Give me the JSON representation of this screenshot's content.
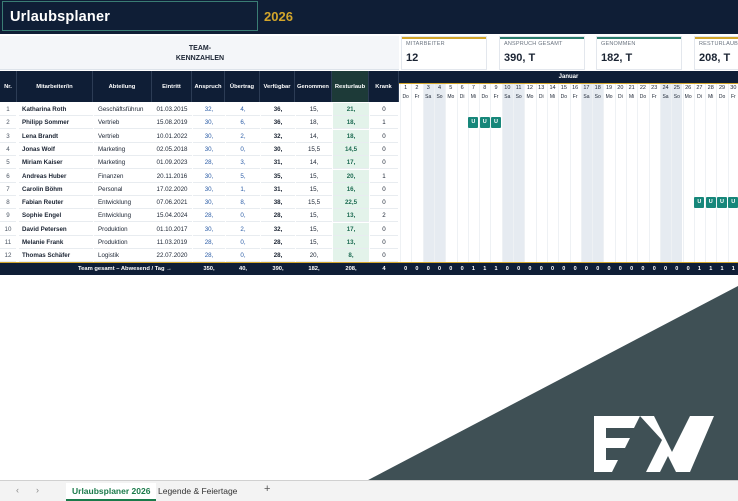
{
  "header": {
    "title": "Urlaubsplaner",
    "year": "2026"
  },
  "kpi": {
    "team_label_1": "TEAM-",
    "team_label_2": "KENNZAHLEN",
    "cards": [
      {
        "label": "MITARBEITER",
        "value": "12",
        "color": "#d2a52b"
      },
      {
        "label": "ANSPRUCH GESAMT",
        "value": "390, T",
        "color": "#2b7d6d"
      },
      {
        "label": "GENOMMEN",
        "value": "182, T",
        "color": "#2b7d6d"
      },
      {
        "label": "RESTURLAUB",
        "value": "208, T",
        "color": "#d2a52b"
      }
    ]
  },
  "table": {
    "headers": {
      "nr": "Nr.",
      "name": "Mitarbeiter/in",
      "dept": "Abteilung",
      "date": "Eintritt",
      "ansp": "Anspruch",
      "uebt": "Übertrag",
      "verf": "Verfügbar",
      "gen": "Genommen",
      "rest": "Resturlaub",
      "krank": "Krank"
    },
    "rows": [
      {
        "nr": "1",
        "name": "Katharina Roth",
        "dept": "Geschäftsführun",
        "date": "01.03.2015",
        "ansp": "32,",
        "uebt": "4,",
        "verf": "36,",
        "gen": "15,",
        "rest": "21,",
        "krank": "0"
      },
      {
        "nr": "2",
        "name": "Philipp Sommer",
        "dept": "Vertrieb",
        "date": "15.08.2019",
        "ansp": "30,",
        "uebt": "6,",
        "verf": "36,",
        "gen": "18,",
        "rest": "18,",
        "krank": "1"
      },
      {
        "nr": "3",
        "name": "Lena Brandt",
        "dept": "Vertrieb",
        "date": "10.01.2022",
        "ansp": "30,",
        "uebt": "2,",
        "verf": "32,",
        "gen": "14,",
        "rest": "18,",
        "krank": "0"
      },
      {
        "nr": "4",
        "name": "Jonas Wolf",
        "dept": "Marketing",
        "date": "02.05.2018",
        "ansp": "30,",
        "uebt": "0,",
        "verf": "30,",
        "gen": "15,5",
        "rest": "14,5",
        "krank": "0"
      },
      {
        "nr": "5",
        "name": "Miriam Kaiser",
        "dept": "Marketing",
        "date": "01.09.2023",
        "ansp": "28,",
        "uebt": "3,",
        "verf": "31,",
        "gen": "14,",
        "rest": "17,",
        "krank": "0"
      },
      {
        "nr": "6",
        "name": "Andreas Huber",
        "dept": "Finanzen",
        "date": "20.11.2016",
        "ansp": "30,",
        "uebt": "5,",
        "verf": "35,",
        "gen": "15,",
        "rest": "20,",
        "krank": "1"
      },
      {
        "nr": "7",
        "name": "Carolin Böhm",
        "dept": "Personal",
        "date": "17.02.2020",
        "ansp": "30,",
        "uebt": "1,",
        "verf": "31,",
        "gen": "15,",
        "rest": "16,",
        "krank": "0"
      },
      {
        "nr": "8",
        "name": "Fabian Reuter",
        "dept": "Entwicklung",
        "date": "07.06.2021",
        "ansp": "30,",
        "uebt": "8,",
        "verf": "38,",
        "gen": "15,5",
        "rest": "22,5",
        "krank": "0"
      },
      {
        "nr": "9",
        "name": "Sophie Engel",
        "dept": "Entwicklung",
        "date": "15.04.2024",
        "ansp": "28,",
        "uebt": "0,",
        "verf": "28,",
        "gen": "15,",
        "rest": "13,",
        "krank": "2"
      },
      {
        "nr": "10",
        "name": "David Petersen",
        "dept": "Produktion",
        "date": "01.10.2017",
        "ansp": "30,",
        "uebt": "2,",
        "verf": "32,",
        "gen": "15,",
        "rest": "17,",
        "krank": "0"
      },
      {
        "nr": "11",
        "name": "Melanie Frank",
        "dept": "Produktion",
        "date": "11.03.2019",
        "ansp": "28,",
        "uebt": "0,",
        "verf": "28,",
        "gen": "15,",
        "rest": "13,",
        "krank": "0"
      },
      {
        "nr": "12",
        "name": "Thomas Schäfer",
        "dept": "Logistik",
        "date": "22.07.2020",
        "ansp": "28,",
        "uebt": "0,",
        "verf": "28,",
        "gen": "20,",
        "rest": "8,",
        "krank": "0"
      }
    ],
    "total": {
      "label": "Team gesamt – Abwesend / Tag →",
      "ansp": "350,",
      "uebt": "40,",
      "verf": "390,",
      "gen": "182,",
      "rest": "208,",
      "krank": "4"
    }
  },
  "calendar": {
    "month": "Januar",
    "days": [
      {
        "d": "1",
        "w": "Do"
      },
      {
        "d": "2",
        "w": "Fr"
      },
      {
        "d": "3",
        "w": "Sa"
      },
      {
        "d": "4",
        "w": "So"
      },
      {
        "d": "5",
        "w": "Mo"
      },
      {
        "d": "6",
        "w": "Di"
      },
      {
        "d": "7",
        "w": "Mi"
      },
      {
        "d": "8",
        "w": "Do"
      },
      {
        "d": "9",
        "w": "Fr"
      },
      {
        "d": "10",
        "w": "Sa"
      },
      {
        "d": "11",
        "w": "So"
      },
      {
        "d": "12",
        "w": "Mo"
      },
      {
        "d": "13",
        "w": "Di"
      },
      {
        "d": "14",
        "w": "Mi"
      },
      {
        "d": "15",
        "w": "Do"
      },
      {
        "d": "16",
        "w": "Fr"
      },
      {
        "d": "17",
        "w": "Sa"
      },
      {
        "d": "18",
        "w": "So"
      },
      {
        "d": "19",
        "w": "Mo"
      },
      {
        "d": "20",
        "w": "Di"
      },
      {
        "d": "21",
        "w": "Mi"
      },
      {
        "d": "22",
        "w": "Do"
      },
      {
        "d": "23",
        "w": "Fr"
      },
      {
        "d": "24",
        "w": "Sa"
      },
      {
        "d": "25",
        "w": "So"
      },
      {
        "d": "26",
        "w": "Mo"
      },
      {
        "d": "27",
        "w": "Di"
      },
      {
        "d": "28",
        "w": "Mi"
      },
      {
        "d": "29",
        "w": "Do"
      },
      {
        "d": "30",
        "w": "Fr"
      }
    ],
    "vacation_mark": "U",
    "vacations": [
      {
        "row": 2,
        "days": [
          7,
          8,
          9
        ]
      },
      {
        "row": 8,
        "days": [
          27,
          28,
          29,
          30
        ]
      }
    ],
    "day_totals": [
      "0",
      "0",
      "0",
      "0",
      "0",
      "0",
      "1",
      "1",
      "1",
      "0",
      "0",
      "0",
      "0",
      "0",
      "0",
      "0",
      "0",
      "0",
      "0",
      "0",
      "0",
      "0",
      "0",
      "0",
      "0",
      "0",
      "1",
      "1",
      "1",
      "1"
    ]
  },
  "tabs": {
    "active": "Urlaubsplaner 2026",
    "second": "Legende & Feiertage",
    "add": "+",
    "prev": "‹",
    "next": "›"
  },
  "colors": {
    "navy": "#0f1e36",
    "teal": "#17877a",
    "gold": "#d2a52b"
  }
}
